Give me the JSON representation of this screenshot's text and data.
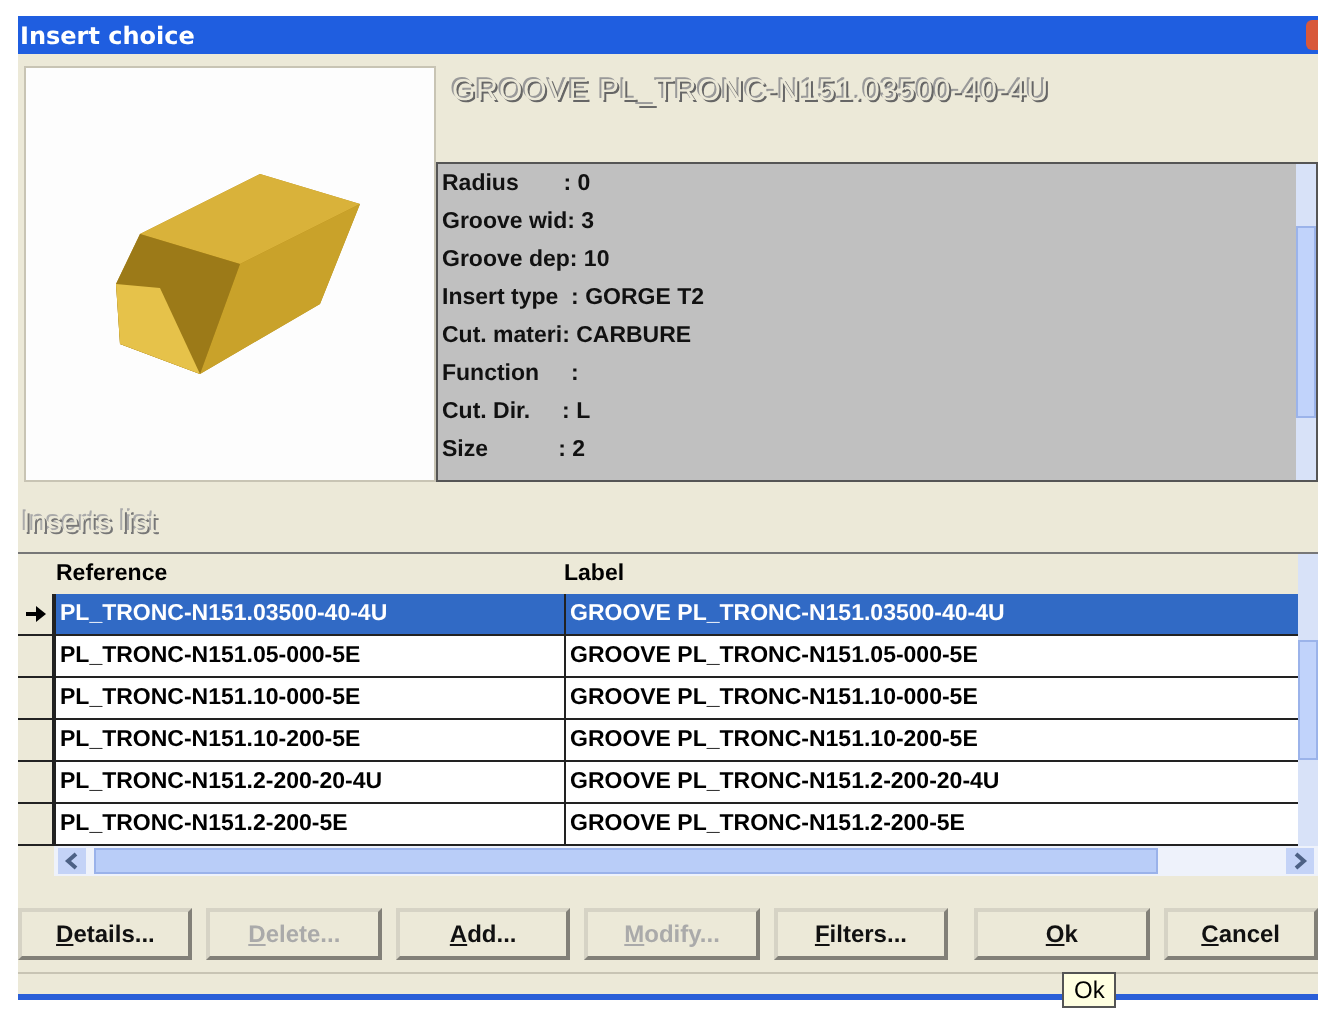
{
  "window": {
    "title": "Insert choice"
  },
  "header": {
    "title": "GROOVE PL_TRONC-N151.03500-40-4U"
  },
  "properties": [
    "Radius       : 0",
    "Groove wid: 3",
    "Groove dep: 10",
    "Insert type  : GORGE T2",
    "Cut. materi: CARBURE",
    "Function     :",
    "Cut. Dir.     : L",
    "Size           : 2"
  ],
  "inserts_list": {
    "title": "Inserts list",
    "columns": [
      "Reference",
      "Label"
    ],
    "rows": [
      {
        "reference": "PL_TRONC-N151.03500-40-4U",
        "label": "GROOVE PL_TRONC-N151.03500-40-4U",
        "selected": true
      },
      {
        "reference": "PL_TRONC-N151.05-000-5E",
        "label": "GROOVE PL_TRONC-N151.05-000-5E",
        "selected": false
      },
      {
        "reference": "PL_TRONC-N151.10-000-5E",
        "label": "GROOVE PL_TRONC-N151.10-000-5E",
        "selected": false
      },
      {
        "reference": "PL_TRONC-N151.10-200-5E",
        "label": "GROOVE PL_TRONC-N151.10-200-5E",
        "selected": false
      },
      {
        "reference": "PL_TRONC-N151.2-200-20-4U",
        "label": "GROOVE PL_TRONC-N151.2-200-20-4U",
        "selected": false
      },
      {
        "reference": "PL_TRONC-N151.2-200-5E",
        "label": "GROOVE PL_TRONC-N151.2-200-5E",
        "selected": false
      }
    ]
  },
  "buttons": [
    {
      "label": "Details...",
      "disabled": false
    },
    {
      "label": "Delete...",
      "disabled": true
    },
    {
      "label": "Add...",
      "disabled": false
    },
    {
      "label": "Modify...",
      "disabled": true
    },
    {
      "label": "Filters...",
      "disabled": false
    },
    {
      "label": "Ok",
      "disabled": false
    },
    {
      "label": "Cancel",
      "disabled": false
    }
  ],
  "tooltip": {
    "text": "Ok"
  }
}
